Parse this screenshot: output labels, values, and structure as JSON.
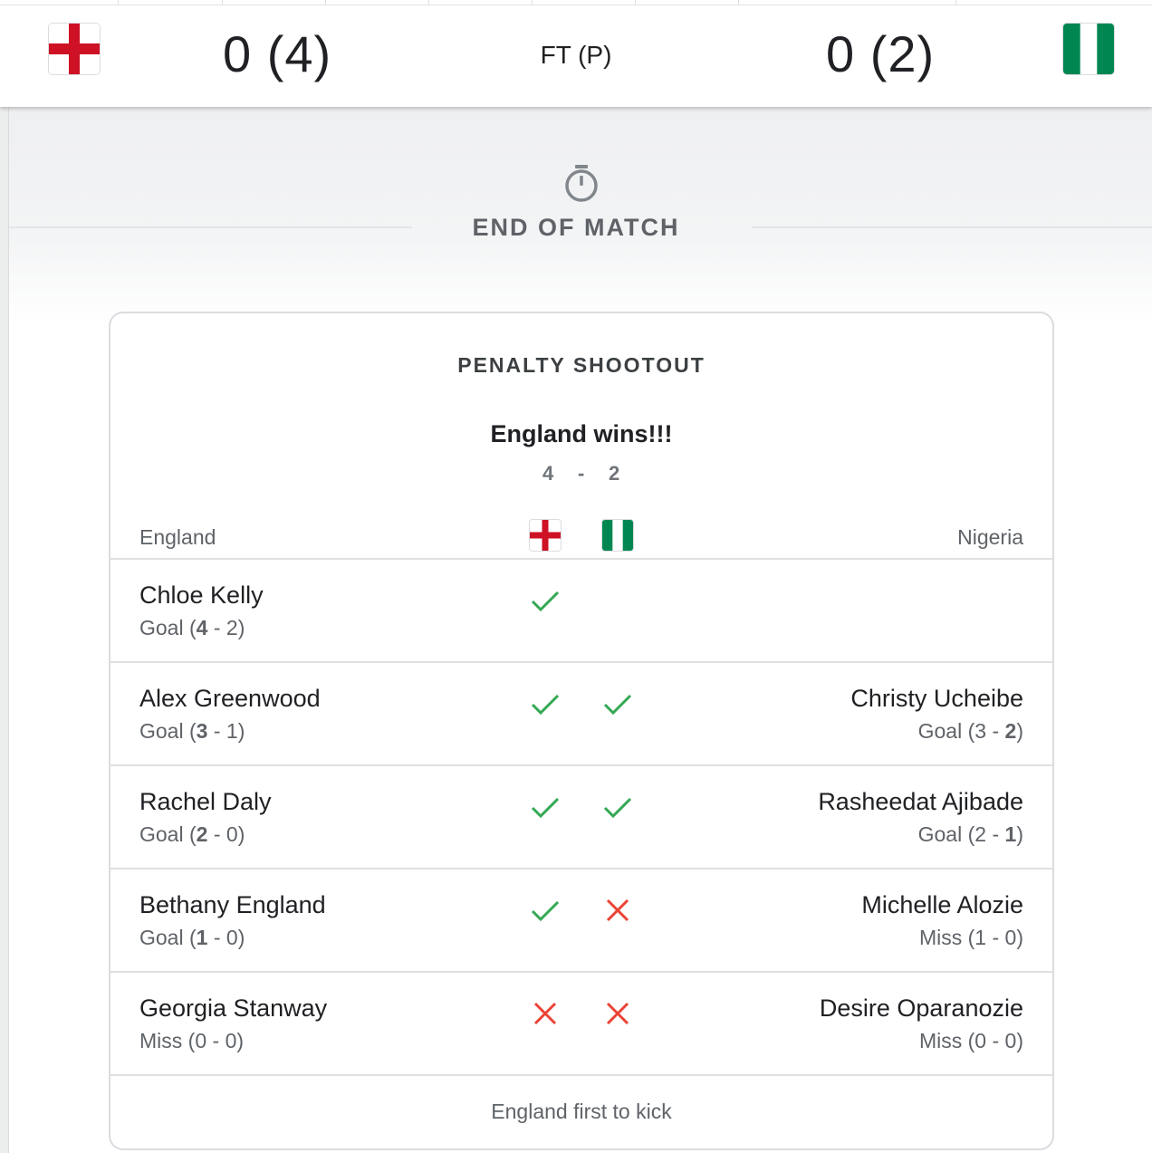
{
  "header": {
    "home_team": "England",
    "away_team": "Nigeria",
    "home_score": "0 (4)",
    "away_score": "0 (2)",
    "status": "FT (P)",
    "home_flag": "england-flag",
    "away_flag": "nigeria-flag"
  },
  "timeline": {
    "label": "END OF MATCH",
    "icon": "stopwatch-icon"
  },
  "shootout": {
    "title": "PENALTY SHOOTOUT",
    "winner_text": "England wins!!!",
    "home_total": "4",
    "separator": "-",
    "away_total": "2",
    "home_label": "England",
    "away_label": "Nigeria",
    "footer": "England first to kick",
    "colors": {
      "goal": "#34a853",
      "miss": "#ea4335"
    },
    "kicks": [
      {
        "home": {
          "name": "Chloe Kelly",
          "outcome": "Goal",
          "score_a": "4",
          "score_b": "2",
          "bold": "a",
          "mark": "check"
        },
        "away": null
      },
      {
        "home": {
          "name": "Alex Greenwood",
          "outcome": "Goal",
          "score_a": "3",
          "score_b": "1",
          "bold": "a",
          "mark": "check"
        },
        "away": {
          "name": "Christy Ucheibe",
          "outcome": "Goal",
          "score_a": "3",
          "score_b": "2",
          "bold": "b",
          "mark": "check"
        }
      },
      {
        "home": {
          "name": "Rachel Daly",
          "outcome": "Goal",
          "score_a": "2",
          "score_b": "0",
          "bold": "a",
          "mark": "check"
        },
        "away": {
          "name": "Rasheedat Ajibade",
          "outcome": "Goal",
          "score_a": "2",
          "score_b": "1",
          "bold": "b",
          "mark": "check"
        }
      },
      {
        "home": {
          "name": "Bethany England",
          "outcome": "Goal",
          "score_a": "1",
          "score_b": "0",
          "bold": "a",
          "mark": "check"
        },
        "away": {
          "name": "Michelle Alozie",
          "outcome": "Miss",
          "score_a": "1",
          "score_b": "0",
          "bold": "",
          "mark": "cross"
        }
      },
      {
        "home": {
          "name": "Georgia Stanway",
          "outcome": "Miss",
          "score_a": "0",
          "score_b": "0",
          "bold": "",
          "mark": "cross"
        },
        "away": {
          "name": "Desire Oparanozie",
          "outcome": "Miss",
          "score_a": "0",
          "score_b": "0",
          "bold": "",
          "mark": "cross"
        }
      }
    ]
  }
}
